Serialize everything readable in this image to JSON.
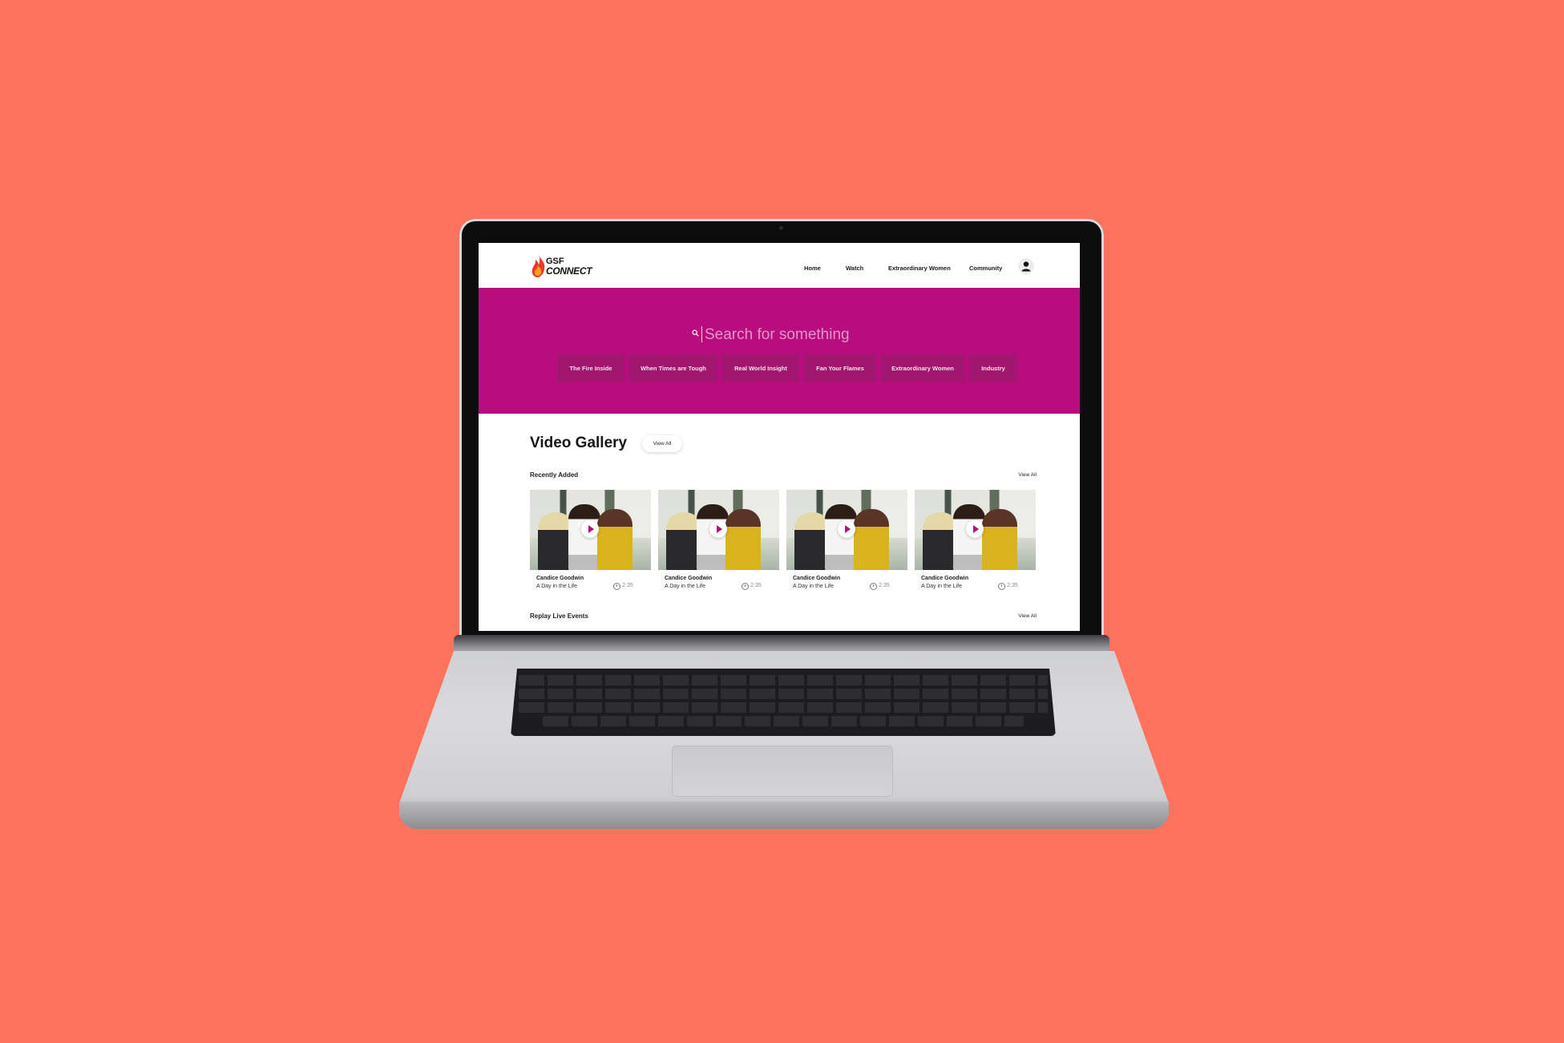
{
  "colors": {
    "background": "#ff725e",
    "brand": "#b80d7e",
    "chip": "#a1166f"
  },
  "logo": {
    "line1": "GSF",
    "line2": "CONNECT"
  },
  "nav": {
    "items": [
      "Home",
      "Watch",
      "Extraordinary Women",
      "Community"
    ],
    "account_icon": "user-icon"
  },
  "hero": {
    "search_placeholder": "Search for something",
    "search_icon": "search-icon",
    "chips": [
      "The Fire Inside",
      "When Times are Tough",
      "Real World Insight",
      "Fan Your Flames",
      "Extraordinary Women",
      "Industry"
    ]
  },
  "gallery": {
    "title": "Video Gallery",
    "view_all": "View All",
    "recent": {
      "label": "Recently Added",
      "view_all": "View All",
      "videos": [
        {
          "author": "Candice Goodwin",
          "title": "A Day in the Life",
          "duration": "2:35"
        },
        {
          "author": "Candice Goodwin",
          "title": "A Day in the Life",
          "duration": "2:35"
        },
        {
          "author": "Candice Goodwin",
          "title": "A Day in the Life",
          "duration": "2:35"
        },
        {
          "author": "Candice Goodwin",
          "title": "A Day in the Life",
          "duration": "2:35"
        }
      ]
    },
    "replay": {
      "label": "Replay Live Events",
      "view_all": "View All"
    }
  }
}
